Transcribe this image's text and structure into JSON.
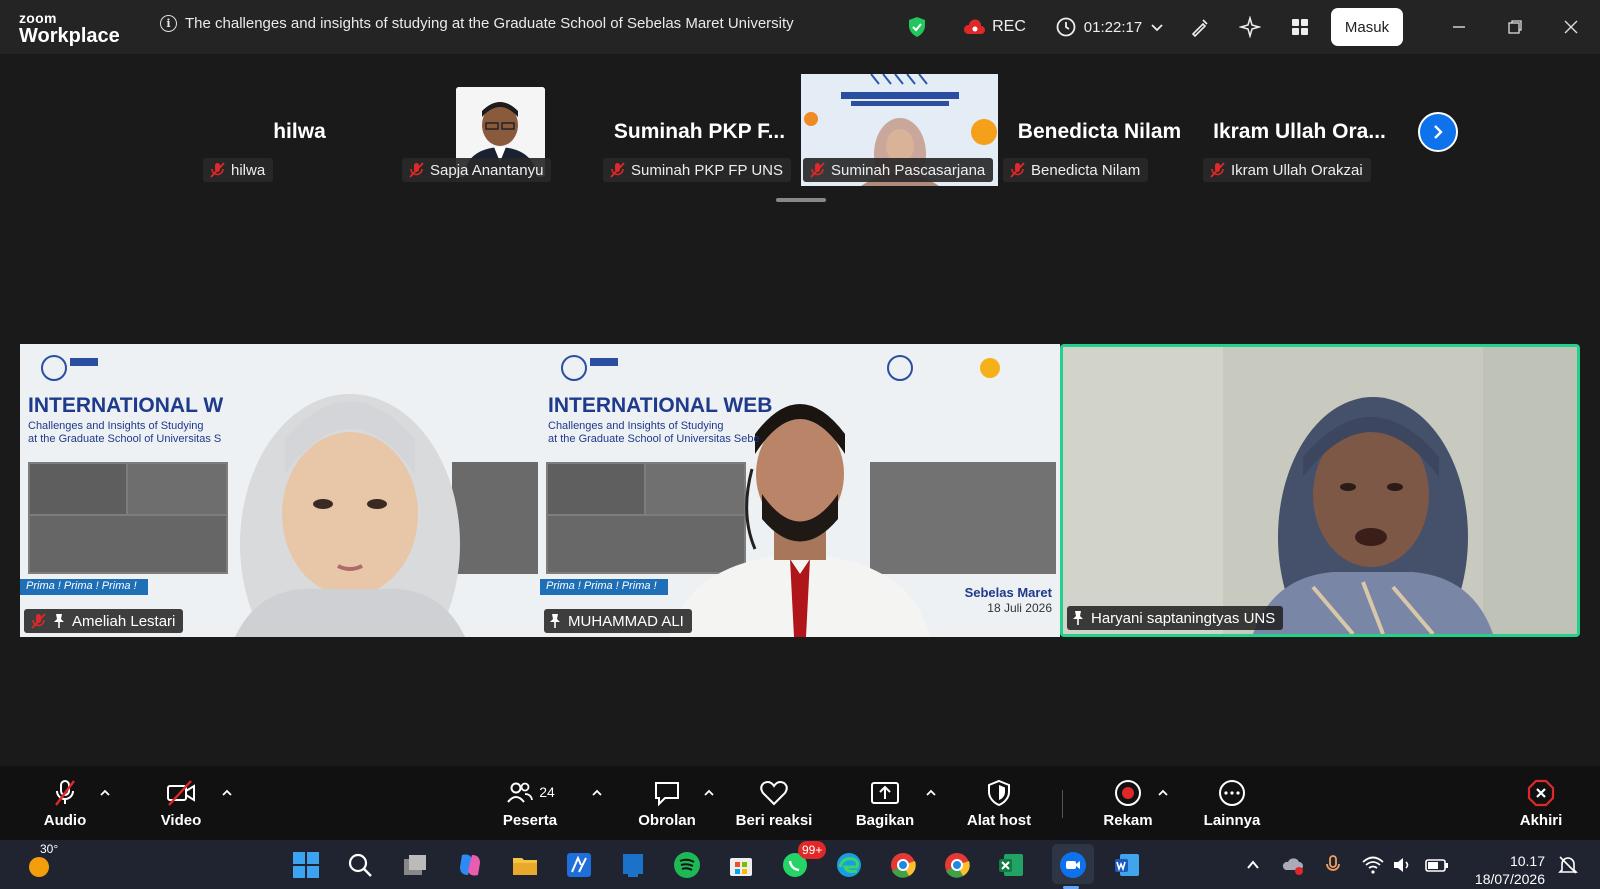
{
  "app": {
    "logo_line1": "zoom",
    "logo_line2": "Workplace",
    "meeting_title": "The challenges and insights of studying at the Graduate School of Sebelas Maret University",
    "rec_label": "REC",
    "timer": "01:22:17",
    "masuk_label": "Masuk"
  },
  "strip": {
    "tiles": [
      {
        "display_name": "hilwa",
        "tag": "hilwa"
      },
      {
        "display_name": "",
        "tag": "Sapja Anantanyu"
      },
      {
        "display_name": "Suminah PKP F...",
        "tag": "Suminah PKP FP UNS"
      },
      {
        "display_name": "",
        "tag": "Suminah Pascasarjana"
      },
      {
        "display_name": "Benedicta Nilam",
        "tag": "Benedicta Nilam"
      },
      {
        "display_name": "Ikram Ullah Ora...",
        "tag": "Ikram Ullah Orakzai"
      }
    ]
  },
  "main": {
    "tiles": [
      {
        "name": "Ameliah Lestari",
        "banner_title": "INTERNATIONAL W",
        "banner_sub1": "Challenges and Insights of Studying",
        "banner_sub2": "at the Graduate School of Universitas S",
        "ribbon": "Prima ! Prima ! Prima !"
      },
      {
        "name": "MUHAMMAD ALI",
        "banner_title": "INTERNATIONAL WEB",
        "banner_sub1": "Challenges and Insights of Studying",
        "banner_sub2": "at the Graduate School of Universitas Sebe",
        "ribbon": "Prima ! Prima ! Prima !",
        "corner1": "Sebelas Maret",
        "corner2": "18 Juli 2026"
      },
      {
        "name": "Haryani saptaningtyas UNS"
      }
    ]
  },
  "toolbar": {
    "audio": "Audio",
    "video": "Video",
    "participants": "Peserta",
    "participants_count": "24",
    "chat": "Obrolan",
    "react": "Beri reaksi",
    "share": "Bagikan",
    "host_tools": "Alat host",
    "record": "Rekam",
    "more": "Lainnya",
    "end": "Akhiri"
  },
  "taskbar": {
    "weather": "30°",
    "badge": "99+",
    "time": "10.17",
    "date": "18/07/2026"
  },
  "colors": {
    "accent": "#0e72ed",
    "active_speaker": "#23d18b",
    "muted": "#e02828"
  }
}
